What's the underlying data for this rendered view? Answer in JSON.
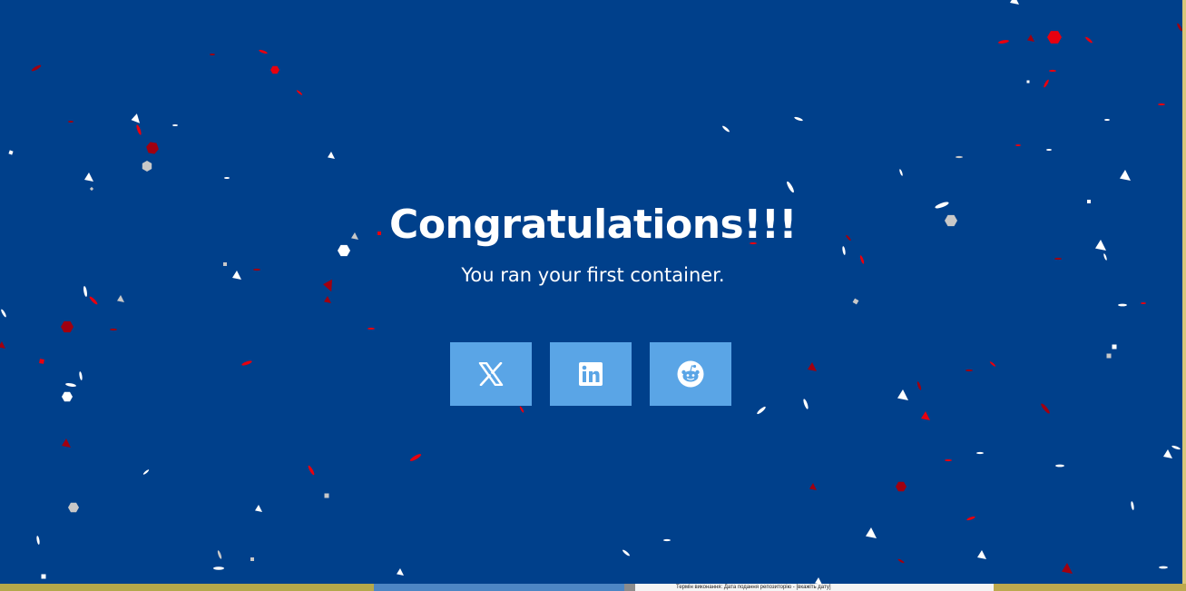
{
  "dialog": {
    "title": "Congratulations!!!",
    "subtitle": "You ran your first container."
  },
  "share": [
    {
      "name": "share-x-button",
      "icon": "x-logo-icon"
    },
    {
      "name": "share-linkedin-button",
      "icon": "linkedin-logo-icon"
    },
    {
      "name": "share-reddit-button",
      "icon": "reddit-logo-icon"
    }
  ],
  "background_window": {
    "strip_text": "Термін виконання: Дата подання репозиторію - [вкажіть дату]"
  },
  "colors": {
    "background": "#00408b",
    "button": "#5aa5e6",
    "confetti_red": "#e8000e",
    "confetti_darkred": "#a00010",
    "confetti_white": "#ffffff",
    "confetti_grey": "#c8c8c8"
  }
}
